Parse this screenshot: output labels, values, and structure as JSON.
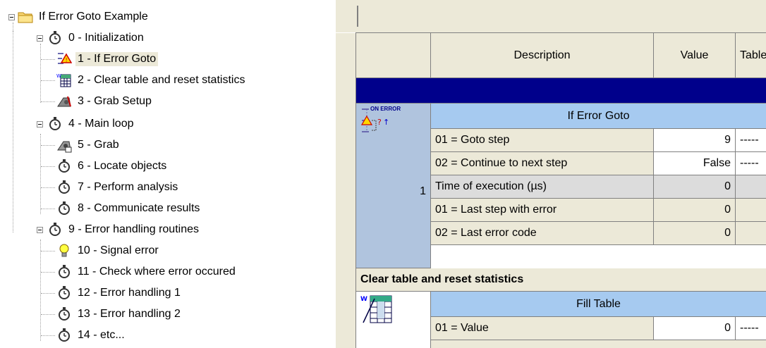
{
  "tree": {
    "root": {
      "label": "If Error Goto Example",
      "icon": "folder-icon"
    },
    "items": [
      {
        "label": "0 - Initialization",
        "icon": "stopwatch-icon",
        "level": 1
      },
      {
        "label": "1 - If Error Goto",
        "icon": "error-goto-icon",
        "level": 2,
        "selected": true
      },
      {
        "label": "2 - Clear table and reset statistics",
        "icon": "table-icon",
        "level": 2
      },
      {
        "label": "3 - Grab Setup",
        "icon": "camera-setup-icon",
        "level": 2
      },
      {
        "label": "4 - Main loop",
        "icon": "stopwatch-icon",
        "level": 1
      },
      {
        "label": "5 - Grab",
        "icon": "camera-icon",
        "level": 2
      },
      {
        "label": "6 - Locate objects",
        "icon": "stopwatch-icon",
        "level": 2
      },
      {
        "label": "7 - Perform analysis",
        "icon": "stopwatch-icon",
        "level": 2
      },
      {
        "label": "8 - Communicate results",
        "icon": "stopwatch-icon",
        "level": 2
      },
      {
        "label": "9 - Error handling routines",
        "icon": "stopwatch-icon",
        "level": 1
      },
      {
        "label": "10 - Signal error",
        "icon": "lightbulb-icon",
        "level": 2
      },
      {
        "label": "11 - Check where error occured",
        "icon": "stopwatch-icon",
        "level": 2
      },
      {
        "label": "12 - Error handling 1",
        "icon": "stopwatch-icon",
        "level": 2
      },
      {
        "label": "13 - Error handling 2",
        "icon": "stopwatch-icon",
        "level": 2
      },
      {
        "label": "14 - etc...",
        "icon": "stopwatch-icon",
        "level": 2
      }
    ]
  },
  "grid": {
    "columns": [
      "Description",
      "Value",
      "Table"
    ],
    "step1": {
      "title": "If Error Goto",
      "row_number": "1",
      "icon_text": "ON ERROR",
      "rows": [
        {
          "desc": "01 = Goto step",
          "value": "9",
          "table": "-----"
        },
        {
          "desc": "02 = Continue to next step",
          "value": "False",
          "table": "-----"
        },
        {
          "desc": "Time of execution (µs)",
          "value": "0",
          "table": ""
        },
        {
          "desc": "01 = Last step with error",
          "value": "0",
          "table": ""
        },
        {
          "desc": "02 = Last error code",
          "value": "0",
          "table": ""
        }
      ]
    },
    "section2_title": "Clear table and reset statistics",
    "step2": {
      "title": "Fill Table",
      "rows": [
        {
          "desc": "01 = Value",
          "value": "0",
          "table": "-----"
        }
      ]
    }
  },
  "colors": {
    "band": "#00008b",
    "step_header": "#a6caf0",
    "left_col": "#b0c4de",
    "panel": "#ece9d8"
  }
}
